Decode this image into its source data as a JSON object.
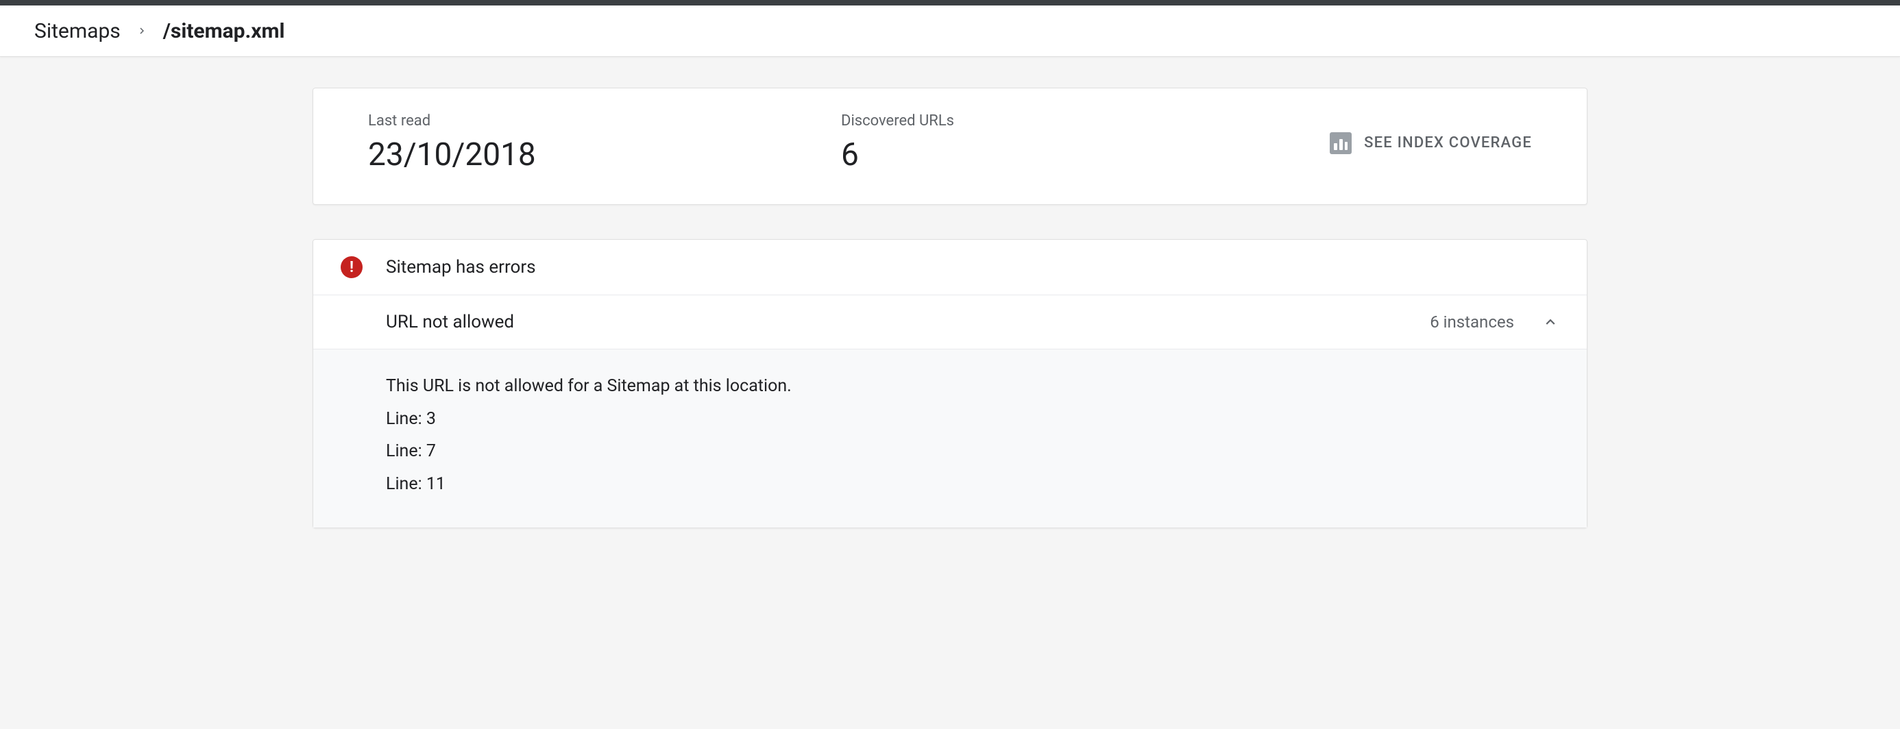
{
  "breadcrumb": {
    "root": "Sitemaps",
    "current": "/sitemap.xml"
  },
  "summary": {
    "last_read_label": "Last read",
    "last_read_value": "23/10/2018",
    "discovered_label": "Discovered URLs",
    "discovered_value": "6",
    "coverage_link": "SEE INDEX COVERAGE"
  },
  "errors": {
    "header": "Sitemap has errors",
    "items": [
      {
        "name": "URL not allowed",
        "count_label": "6 instances",
        "details": [
          "This URL is not allowed for a Sitemap at this location.",
          "Line: 3",
          "Line: 7",
          "Line: 11"
        ]
      }
    ]
  }
}
